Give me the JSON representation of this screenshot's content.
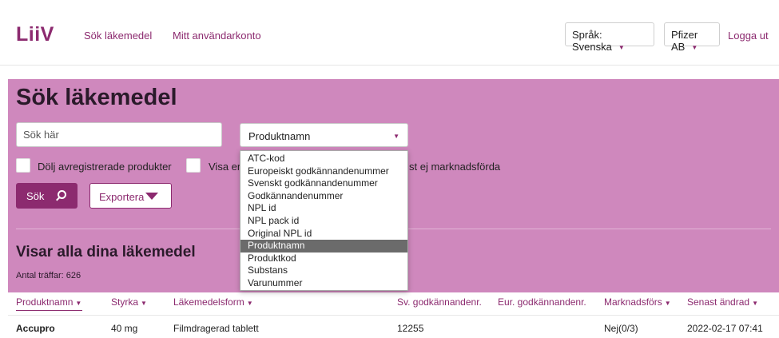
{
  "header": {
    "logo": "LiiV",
    "nav": [
      "Sök läkemedel",
      "Mitt användarkonto"
    ],
    "language_select": "Språk: Svenska",
    "company_select": "Pfizer AB",
    "logout": "Logga ut"
  },
  "search": {
    "title": "Sök läkemedel",
    "placeholder": "Sök här",
    "field_value": "Produktnamn",
    "checkbox_1": "Dölj avregistrerade produkter",
    "checkbox_2_visible": "Visa en",
    "checkbox_3_visible": "st ej marknadsförda",
    "search_button": "Sök",
    "export_button": "Exportera"
  },
  "dropdown": {
    "options": [
      "ATC-kod",
      "Europeiskt godkännandenummer",
      "Svenskt godkännandenummer",
      "Godkännandenummer",
      "NPL id",
      "NPL pack id",
      "Original NPL id",
      "Produktnamn",
      "Produktkod",
      "Substans",
      "Varunummer"
    ],
    "selected": "Produktnamn"
  },
  "results": {
    "title": "Visar alla dina läkemedel",
    "count": "Antal träffar: 626"
  },
  "table": {
    "columns": [
      "Produktnamn",
      "Styrka",
      "Läkemedelsform",
      "Sv. godkännandenr.",
      "Eur. godkännandenr.",
      "Marknadsförs",
      "Senast ändrad"
    ],
    "rows": [
      [
        "Accupro",
        "40 mg",
        "Filmdragerad tablett",
        "12255",
        "",
        "Nej(0/3)",
        "2022-02-17 07:41"
      ]
    ]
  },
  "colors": {
    "brand": "#8c2a6f",
    "panel": "#cf88bd"
  }
}
